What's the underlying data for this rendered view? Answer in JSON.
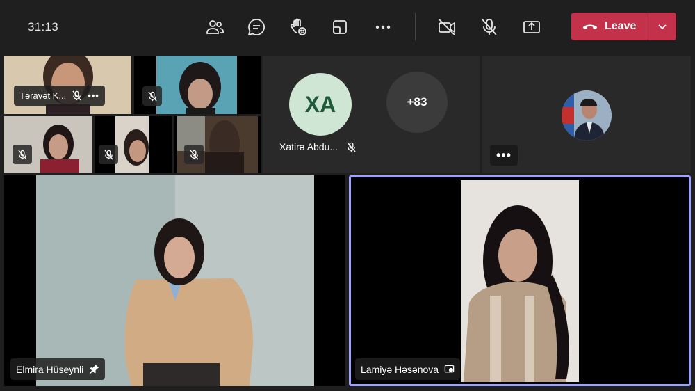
{
  "meeting": {
    "timer": "31:13",
    "leave_label": "Leave"
  },
  "toolbar": {
    "icons": [
      "people-icon",
      "chat-icon",
      "raise-hand-icon",
      "rooms-icon",
      "more-icon",
      "camera-off-icon",
      "mic-off-icon",
      "share-icon"
    ]
  },
  "colors": {
    "background": "#1f1f1f",
    "leave": "#c4314b",
    "active_speaker_border": "#9ea2ff",
    "avatar_xa": "#cfe6d4"
  },
  "participants": {
    "p1": {
      "name": "Təravət K..."
    },
    "xa": {
      "initials": "XA",
      "name": "Xatirə Abdu..."
    },
    "overflow": {
      "label": "+83"
    },
    "elmira": {
      "name": "Elmira Hüseynli"
    },
    "lamiye": {
      "name": "Lamiyə Həsənova"
    }
  }
}
